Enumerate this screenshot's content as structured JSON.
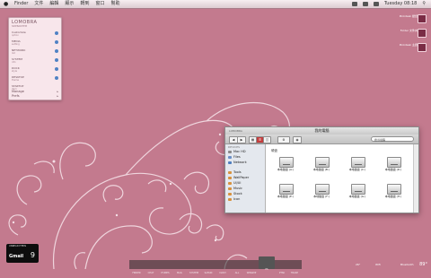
{
  "menubar": {
    "apple": "",
    "items": [
      "Finder",
      "文件",
      "編輯",
      "顯示",
      "轉到",
      "窗口",
      "幫助"
    ],
    "clock": "Tuesday 08:18"
  },
  "widget": {
    "title": "LOMOBRA",
    "subtitle": "SIDEBARITEM",
    "rows": [
      {
        "a": "Customize",
        "b": "option"
      },
      {
        "a": "MEDIA",
        "b": "setting"
      },
      {
        "a": "NETWORK",
        "b": "list"
      },
      {
        "a": "SYSTEM",
        "b": "info"
      },
      {
        "a": "DOCK",
        "b": "style"
      },
      {
        "a": "DESKTOP",
        "b": "theme"
      },
      {
        "a": "STARTUP",
        "b": "item"
      }
    ],
    "bottom_items": [
      "Manage",
      "Prefs"
    ]
  },
  "desktop_icons": [
    {
      "label": "Pinkdesk 壁纸"
    },
    {
      "label": "Folder 文件夹"
    },
    {
      "label": "Pinkdesk 主题"
    }
  ],
  "finder": {
    "brand": "LOMOBRA",
    "title": "我的電腦",
    "search_placeholder": "搜尋電腦",
    "content_header": "硬盘",
    "sidebar_header": "DEVICES",
    "sidebar": {
      "devices": [
        "Mac HD",
        "Files",
        "Network"
      ],
      "places": [
        "Tools",
        "WallPaper",
        "UI/UI",
        "Music",
        "Stock",
        "Icon"
      ]
    },
    "drives": [
      "本地磁盘 (A:)",
      "本地磁盘 (B:)",
      "本地磁盘 (C:)",
      "本地磁盘 (D:)",
      "本地磁盘 (E:)",
      "本地磁盘 (F:)",
      "本地磁盘 (G:)",
      "本地磁盘 (H:)"
    ]
  },
  "gmail": {
    "unread_label": "UNREAD ITEMS",
    "name": "Gmail",
    "count": "9"
  },
  "dock": {
    "items": [
      "FINDER",
      "CHAT",
      "ITUNES",
      "MAIL",
      "SYSTEM",
      "SAFARI",
      "DASH",
      "ALL",
      "WINAMP",
      "PS",
      "PTSK",
      "TRASH"
    ]
  },
  "status_right": {
    "weather": "26°",
    "net": "Wifi",
    "misc": "Bluetooth",
    "battery": "89°"
  }
}
